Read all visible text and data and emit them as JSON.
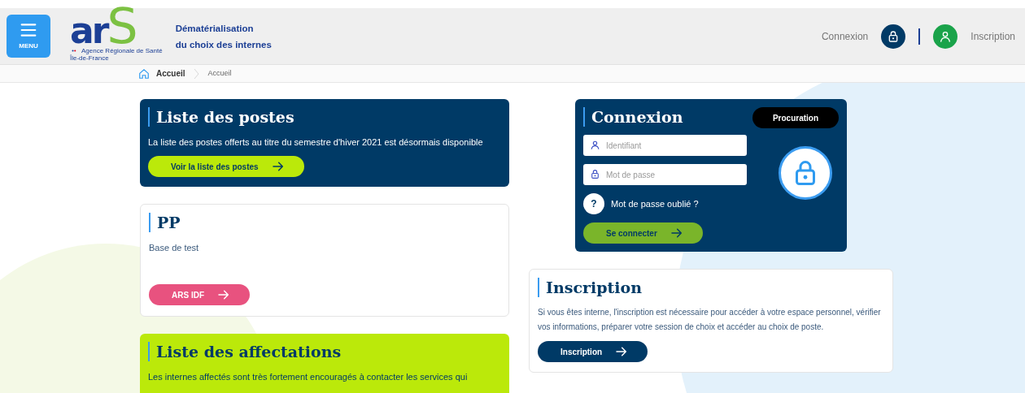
{
  "header": {
    "menu_label": "MENU",
    "logo": {
      "letters": "ar",
      "accent": "S",
      "line_1": "Agence Régionale de Santé",
      "line_2": "Île-de-France"
    },
    "site_title": [
      "Dématérialisation",
      "du choix des internes"
    ],
    "top_links": [
      {
        "kind": "login",
        "label": "Connexion"
      },
      {
        "kind": "signup",
        "label": "Inscription"
      }
    ]
  },
  "breadcrumb": [
    {
      "label": "Accueil",
      "kind": "home"
    },
    {
      "label": "Accueil",
      "kind": "current"
    }
  ],
  "left_cards": [
    {
      "kind": "dark",
      "title": "Liste des postes",
      "text": "La liste des postes offerts au titre du semestre d'hiver 2021 est désormais disponible",
      "button": {
        "label": "Voir la liste des postes",
        "kind": "lime"
      }
    },
    {
      "kind": "light",
      "title": "PP",
      "text": "Base de test",
      "button": {
        "label": "ARS IDF",
        "kind": "pink"
      }
    },
    {
      "kind": "lime",
      "title": "Liste des affectations",
      "text": "Les internes affectés sont très fortement encouragés à contacter les services qui"
    }
  ],
  "login_card": {
    "title": "Connexion",
    "proxy_button": "Procuration",
    "fields": [
      {
        "kind": "user",
        "placeholder": "Identifiant"
      },
      {
        "kind": "password",
        "placeholder": "Mot de passe"
      }
    ],
    "forgot_icon": "?",
    "forgot_label": "Mot de passe oublié ?",
    "submit": "Se connecter"
  },
  "signup_card": {
    "title": "Inscription",
    "text": "Si vous êtes interne, l'inscription est nécessaire pour accéder à votre espace personnel, vérifier vos informations, préparer votre session de choix et accéder au choix de poste.",
    "button": "Inscription"
  }
}
